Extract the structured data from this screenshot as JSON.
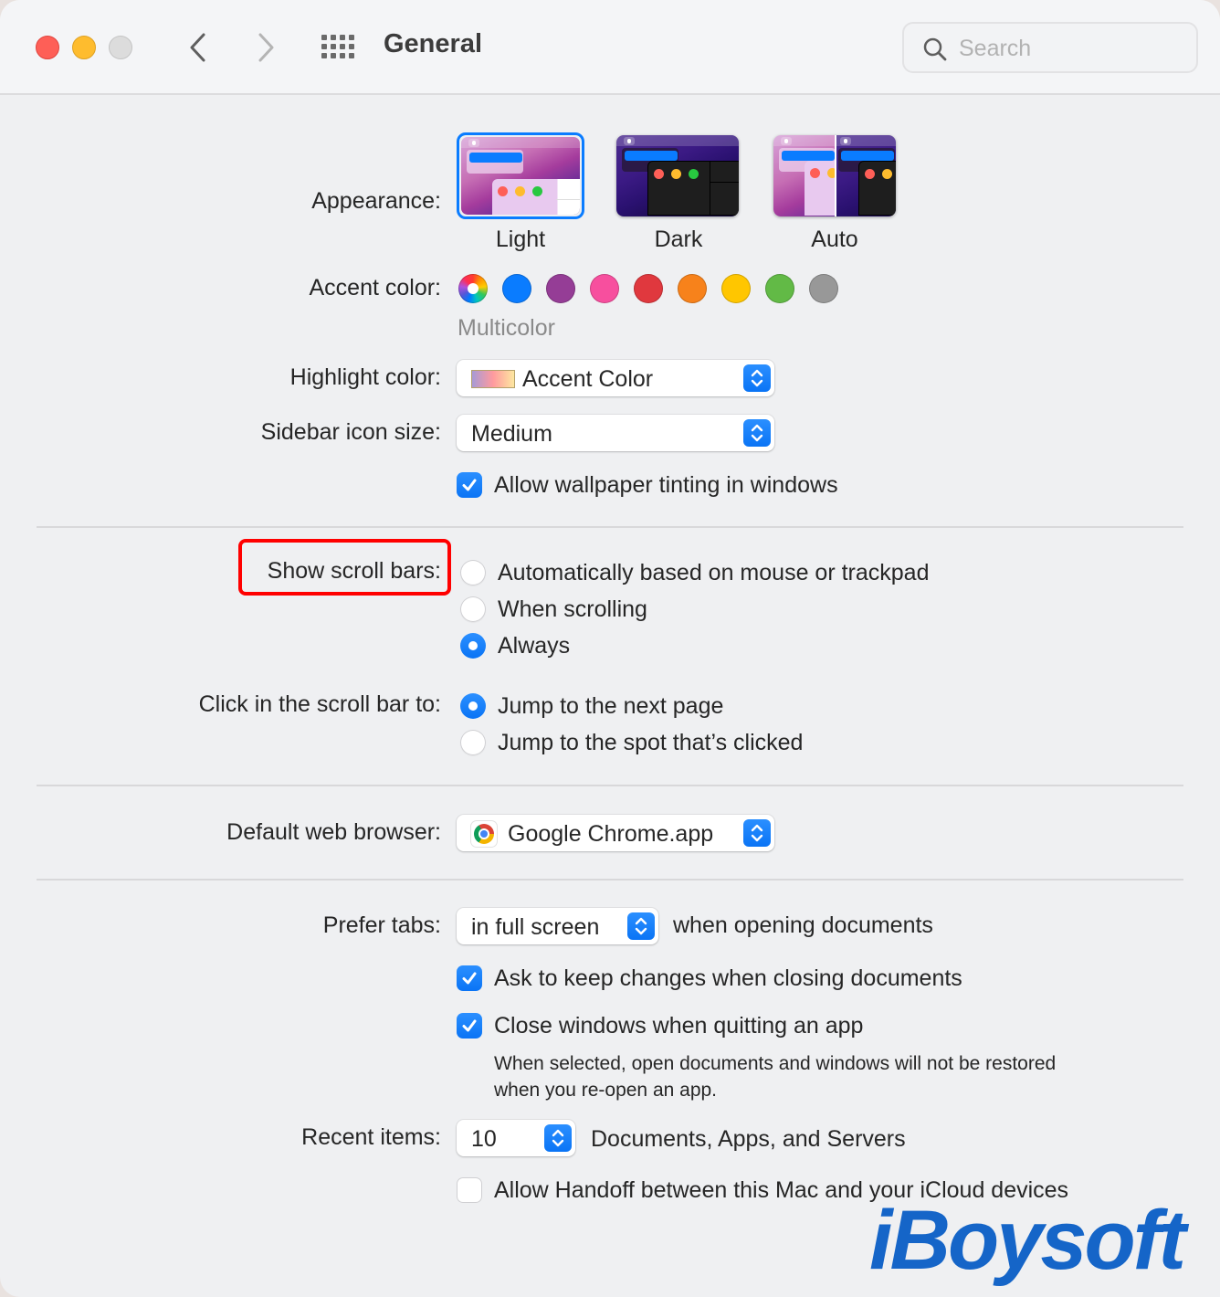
{
  "window": {
    "title": "General",
    "search": {
      "placeholder": "Search",
      "value": ""
    }
  },
  "appearance": {
    "label": "Appearance:",
    "options": [
      {
        "name": "Light",
        "selected": true
      },
      {
        "name": "Dark",
        "selected": false
      },
      {
        "name": "Auto",
        "selected": false
      }
    ]
  },
  "accent": {
    "label": "Accent color:",
    "selected_name": "Multicolor",
    "colors": [
      {
        "name": "Multicolor",
        "hex": "multicolor",
        "selected": true
      },
      {
        "name": "Blue",
        "hex": "#0a7cff",
        "selected": false
      },
      {
        "name": "Purple",
        "hex": "#953d96",
        "selected": false
      },
      {
        "name": "Pink",
        "hex": "#f74f9e",
        "selected": false
      },
      {
        "name": "Red",
        "hex": "#e0383e",
        "selected": false
      },
      {
        "name": "Orange",
        "hex": "#f7821b",
        "selected": false
      },
      {
        "name": "Yellow",
        "hex": "#ffc600",
        "selected": false
      },
      {
        "name": "Green",
        "hex": "#62ba46",
        "selected": false
      },
      {
        "name": "Graphite",
        "hex": "#989898",
        "selected": false
      }
    ]
  },
  "highlight": {
    "label": "Highlight color:",
    "value": "Accent Color"
  },
  "sidebar_icon_size": {
    "label": "Sidebar icon size:",
    "value": "Medium"
  },
  "wallpaper_tinting": {
    "label": "Allow wallpaper tinting in windows",
    "checked": true
  },
  "scroll_bars": {
    "label": "Show scroll bars:",
    "options": [
      {
        "label": "Automatically based on mouse or trackpad",
        "selected": false
      },
      {
        "label": "When scrolling",
        "selected": false
      },
      {
        "label": "Always",
        "selected": true
      }
    ]
  },
  "click_scroll_bar": {
    "label": "Click in the scroll bar to:",
    "options": [
      {
        "label": "Jump to the next page",
        "selected": true
      },
      {
        "label": "Jump to the spot that’s clicked",
        "selected": false
      }
    ]
  },
  "default_browser": {
    "label": "Default web browser:",
    "value": "Google Chrome.app"
  },
  "prefer_tabs": {
    "label": "Prefer tabs:",
    "value": "in full screen",
    "suffix": "when opening documents"
  },
  "ask_keep_changes": {
    "label": "Ask to keep changes when closing documents",
    "checked": true
  },
  "close_windows": {
    "label": "Close windows when quitting an app",
    "checked": true,
    "note_line1": "When selected, open documents and windows will not be restored",
    "note_line2": "when you re-open an app."
  },
  "recent_items": {
    "label": "Recent items:",
    "value": "10",
    "suffix": "Documents, Apps, and Servers"
  },
  "handoff": {
    "label": "Allow Handoff between this Mac and your iCloud devices",
    "checked": false
  },
  "watermark": {
    "text": "iBoysoft"
  },
  "colors": {
    "accent": "#0a7cff",
    "annotation": "#ff0000"
  }
}
